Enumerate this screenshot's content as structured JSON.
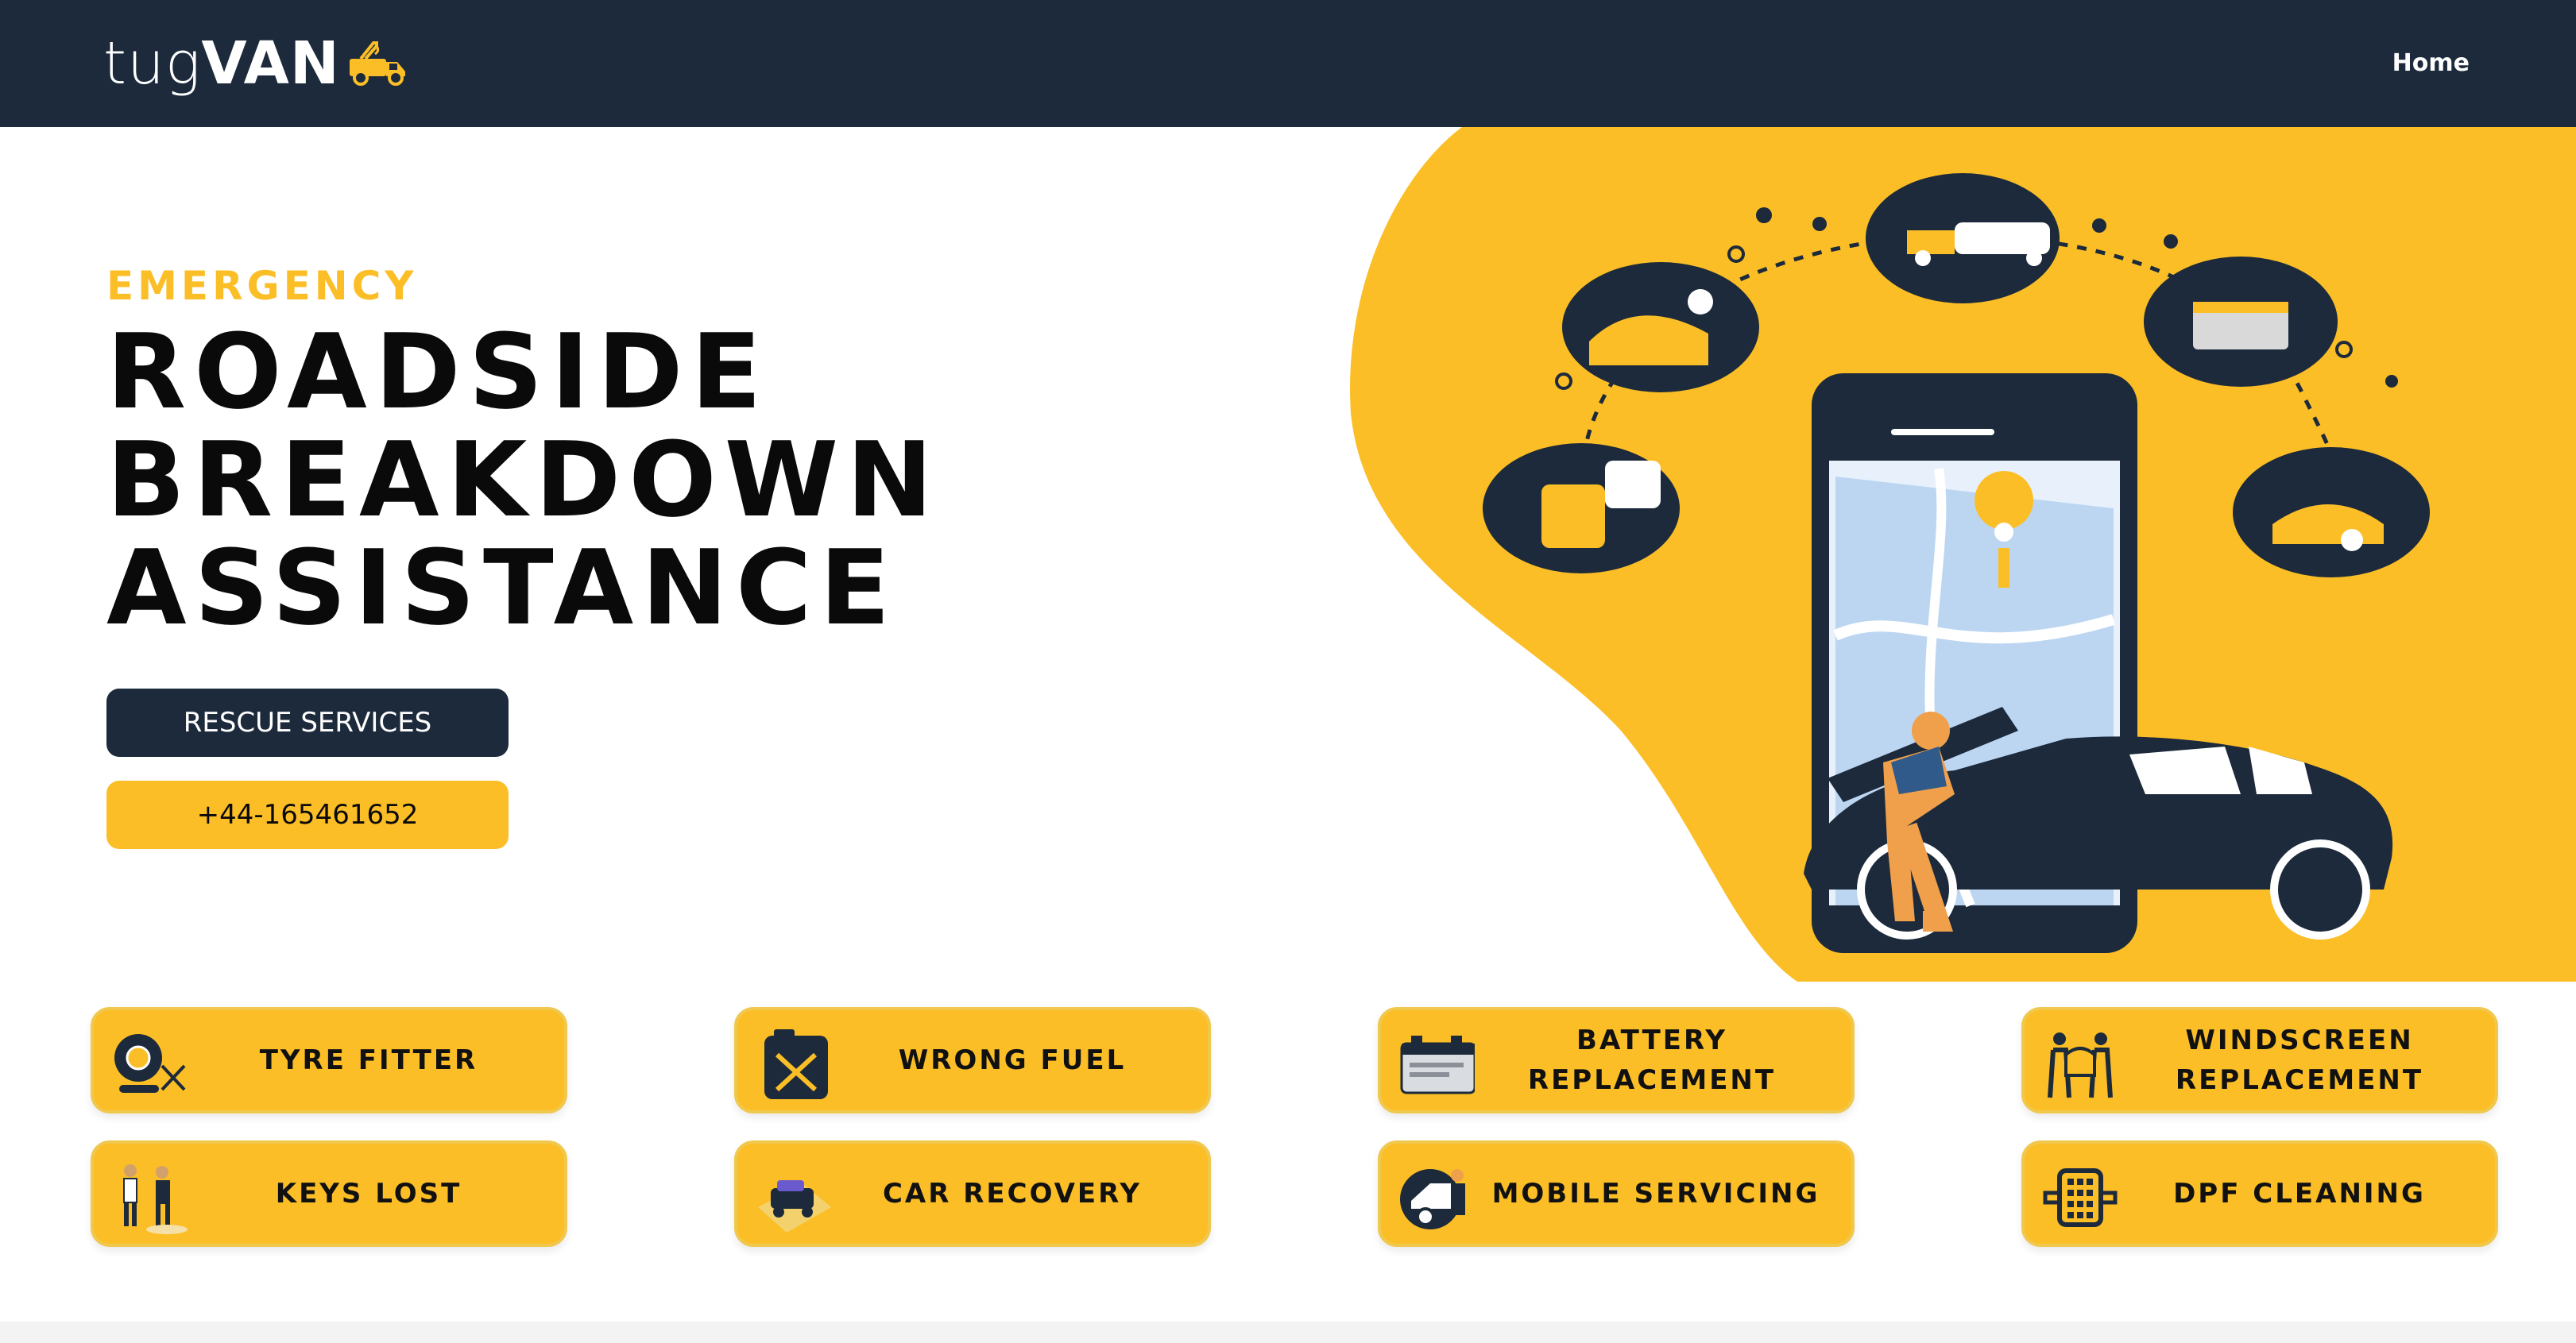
{
  "brand": {
    "name_light": "tug",
    "name_bold": "VAN",
    "logo_icon": "tow-truck-icon"
  },
  "nav": {
    "home_label": "Home"
  },
  "hero": {
    "eyebrow": "EMERGENCY",
    "headline_lines": [
      "ROADSIDE",
      "BREAKDOWN",
      "ASSISTANCE"
    ],
    "primary_button": "RESCUE SERVICES",
    "phone_button": "+44-165461652"
  },
  "services": [
    {
      "label": "TYRE FITTER",
      "icon": "tyre-icon"
    },
    {
      "label": "WRONG FUEL",
      "icon": "jerrycan-icon"
    },
    {
      "label": "BATTERY REPLACEMENT",
      "icon": "battery-icon"
    },
    {
      "label": "WINDSCREEN REPLACEMENT",
      "icon": "windscreen-fitters-icon"
    },
    {
      "label": "KEYS LOST",
      "icon": "people-keys-icon"
    },
    {
      "label": "CAR RECOVERY",
      "icon": "tow-truck-icon"
    },
    {
      "label": "MOBILE SERVICING",
      "icon": "mechanic-icon"
    },
    {
      "label": "DPF CLEANING",
      "icon": "dpf-filter-icon"
    }
  ],
  "colors": {
    "navy": "#1c2a3b",
    "accent": "#fbbe26",
    "white": "#ffffff"
  }
}
